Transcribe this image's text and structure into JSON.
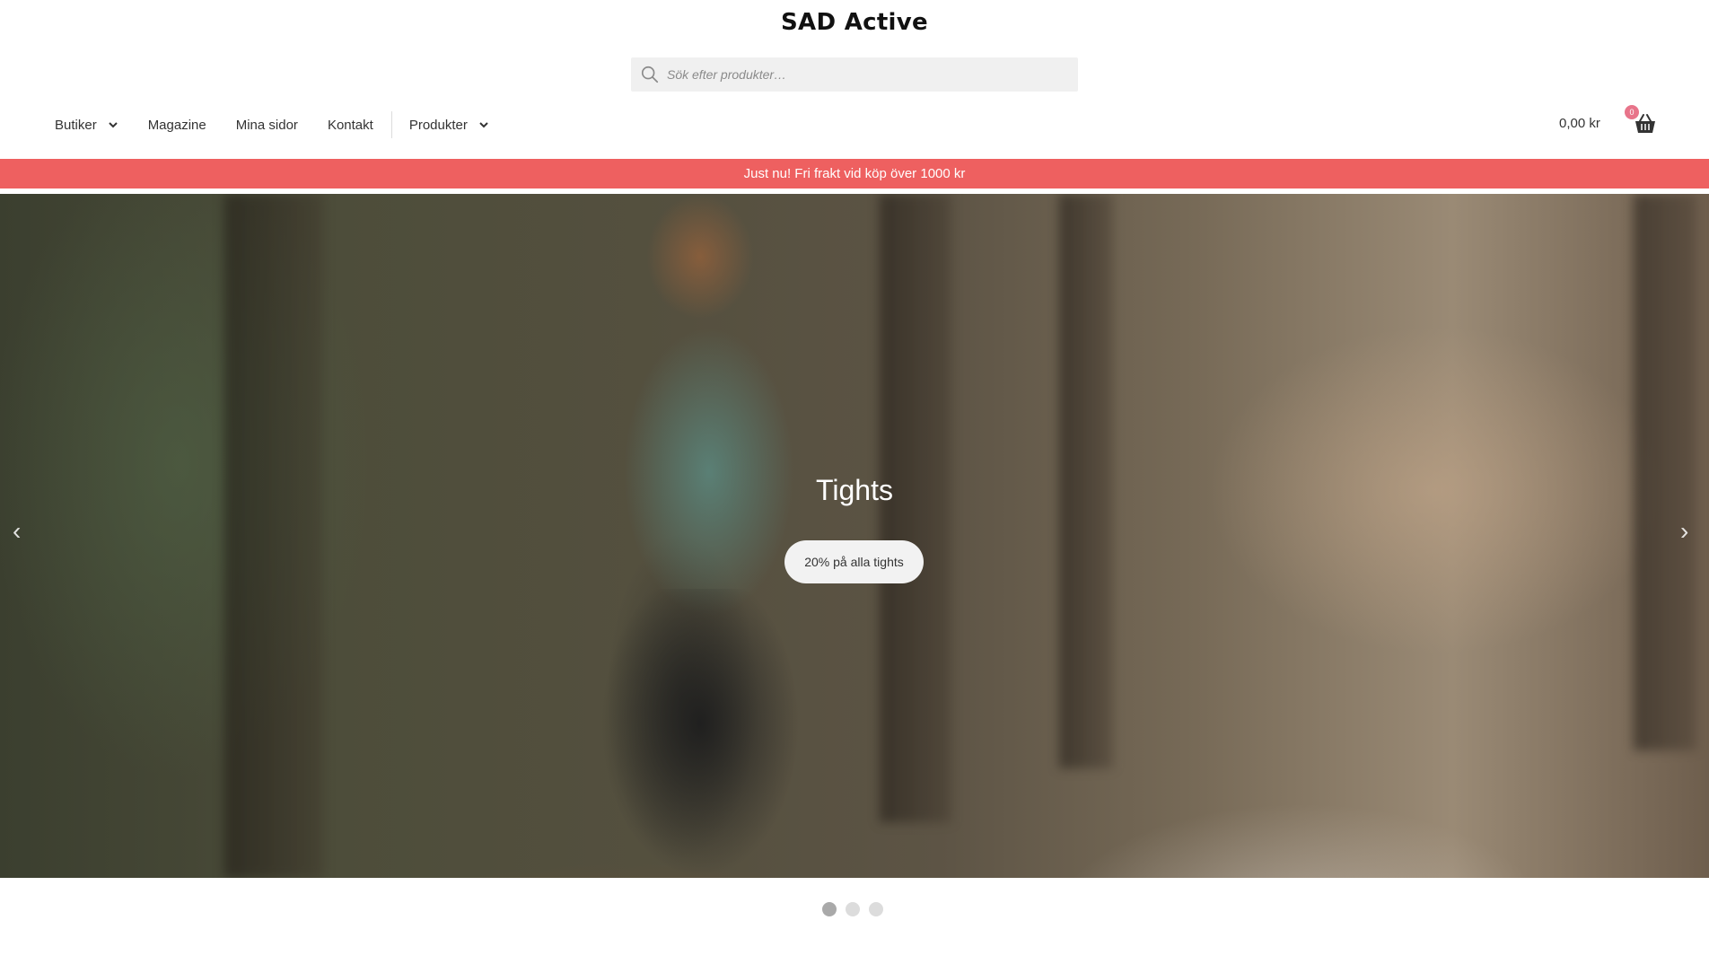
{
  "site": {
    "title": "SAD Active"
  },
  "search": {
    "placeholder": "Sök efter produkter…"
  },
  "nav": {
    "items": [
      {
        "label": "Butiker",
        "dropdown": true
      },
      {
        "label": "Magazine",
        "dropdown": false
      },
      {
        "label": "Mina sidor",
        "dropdown": false
      },
      {
        "label": "Kontakt",
        "dropdown": false
      },
      {
        "label": "Produkter",
        "dropdown": true
      }
    ]
  },
  "cart": {
    "total": "0,00 kr",
    "count": "0",
    "icon": "basket-icon"
  },
  "promo": {
    "text": "Just nu! Fri frakt vid köp över 1000 kr",
    "bg_color": "#ee6060"
  },
  "hero": {
    "title": "Tights",
    "button_label": "20% på alla tights",
    "prev_label": "‹",
    "next_label": "›",
    "slides": 3,
    "active_slide": 1
  }
}
